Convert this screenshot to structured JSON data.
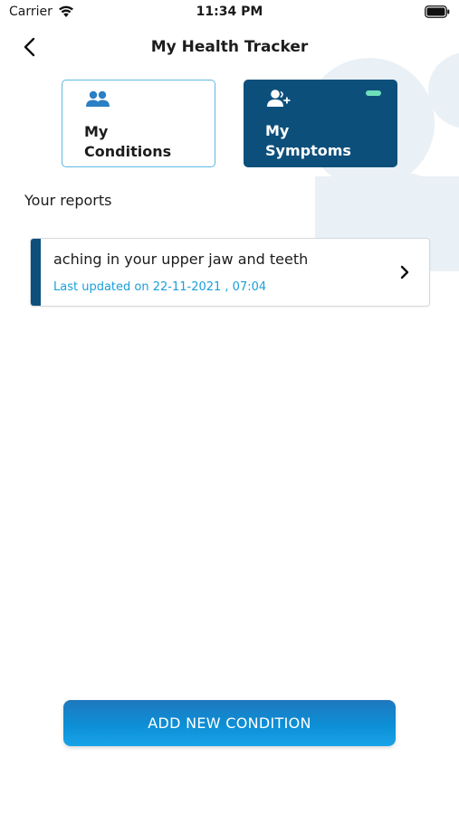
{
  "status_bar": {
    "carrier": "Carrier",
    "time": "11:34 PM"
  },
  "header": {
    "title": "My Health Tracker"
  },
  "tabs": [
    {
      "label_line1": "My",
      "label_line2": "Conditions",
      "icon": "people-icon",
      "selected": false
    },
    {
      "label_line1": "My",
      "label_line2": "Symptoms",
      "icon": "add-person-icon",
      "selected": true
    }
  ],
  "reports": {
    "heading": "Your reports",
    "items": [
      {
        "title": "aching in your upper jaw and teeth",
        "updated": "Last updated on 22-11-2021 , 07:04"
      }
    ]
  },
  "actions": {
    "add_label": "ADD NEW CONDITION"
  },
  "colors": {
    "primary": "#0d4f7b",
    "accent_blue": "#1aa0db",
    "tab_border": "#5fb8e2",
    "indicator": "#6ee0b9"
  }
}
